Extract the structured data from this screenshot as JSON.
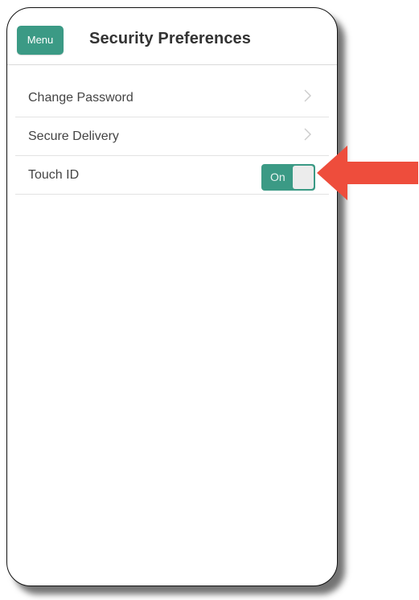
{
  "header": {
    "menu_label": "Menu",
    "title": "Security Preferences"
  },
  "settings": {
    "items": [
      {
        "label": "Change Password"
      },
      {
        "label": "Secure Delivery"
      },
      {
        "label": "Touch ID",
        "toggle_label": "On",
        "toggle_state": true
      }
    ]
  },
  "icons": {
    "chevron": "chevron-right-icon",
    "annotation": "arrow-left-icon"
  },
  "colors": {
    "accent": "#3b9a85",
    "annotation_arrow": "#ee4d3c",
    "title_text": "#333333",
    "row_text": "#444444"
  }
}
